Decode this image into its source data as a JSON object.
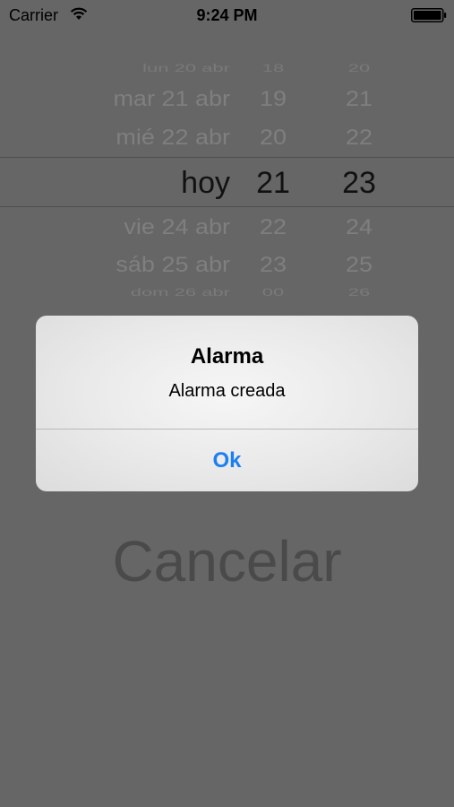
{
  "status_bar": {
    "carrier": "Carrier",
    "time": "9:24 PM",
    "icons": [
      "wifi-icon",
      "battery-icon"
    ]
  },
  "date_picker": {
    "selected": {
      "day": "hoy",
      "hour": "21",
      "minute": "23"
    },
    "rows": [
      {
        "day": "lun 20 abr",
        "hour": "18",
        "minute": "20"
      },
      {
        "day": "mar 21 abr",
        "hour": "19",
        "minute": "21"
      },
      {
        "day": "mié 22 abr",
        "hour": "20",
        "minute": "22"
      },
      {
        "day": "hoy",
        "hour": "21",
        "minute": "23"
      },
      {
        "day": "vie 24 abr",
        "hour": "22",
        "minute": "24"
      },
      {
        "day": "sáb 25 abr",
        "hour": "23",
        "minute": "25"
      },
      {
        "day": "dom 26 abr",
        "hour": "00",
        "minute": "26"
      }
    ]
  },
  "cancel_button": {
    "label": "Cancelar"
  },
  "alert": {
    "title": "Alarma",
    "message": "Alarma creada",
    "ok_label": "Ok"
  },
  "colors": {
    "dimmed_background": "#666666",
    "alert_button_blue": "#1b7ef2"
  }
}
